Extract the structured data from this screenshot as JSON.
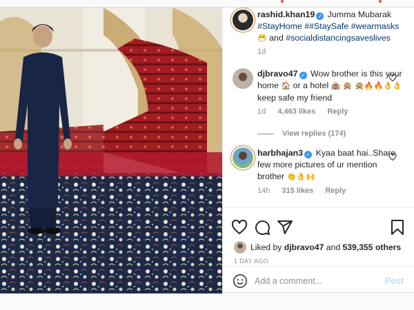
{
  "post": {
    "caption": {
      "username": "rashid.khan19",
      "text_before": "Jumma Mubarak",
      "tags": [
        "#StayHome",
        "##StaySafe",
        "#wearmasks"
      ],
      "emoji": "😷",
      "and_text": "and",
      "final_tag": "#socialdistancingsaveslives",
      "time": "1d"
    },
    "comments": [
      {
        "username": "djbravo47",
        "text_1": "Wow brother is this your home",
        "emoji_1": "🏠",
        "text_2": "or a hotel",
        "emoji_2": "🏨",
        "emoji_3": "🙊",
        "emoji_4": "🙊🔥🔥👌👌",
        "text_3": "keep safe my friend",
        "time": "1d",
        "likes": "4,463 likes",
        "reply": "Reply",
        "view_replies": "View replies (174)"
      },
      {
        "username": "harbhajan3",
        "text": "Kyaa baat hai..Share few more pictures of ur mention brother",
        "emojis": "👏👌🙌",
        "time": "14h",
        "likes": "315 likes",
        "reply": "Reply"
      }
    ],
    "liked_by": {
      "prefix": "Liked by",
      "user": "djbravo47",
      "and": "and",
      "count": "539,355 others"
    },
    "age": "1 DAY AGO",
    "comment_box": {
      "placeholder": "Add a comment...",
      "post_label": "Post"
    },
    "icons": {
      "like": "heart-icon",
      "comment": "comment-icon",
      "share": "share-icon",
      "save": "bookmark-icon",
      "emoji": "smile-icon"
    },
    "colors": {
      "link": "#00376b",
      "verified": "#3897f0",
      "muted": "#8e8e8e",
      "post_button": "#b2dffc"
    }
  }
}
